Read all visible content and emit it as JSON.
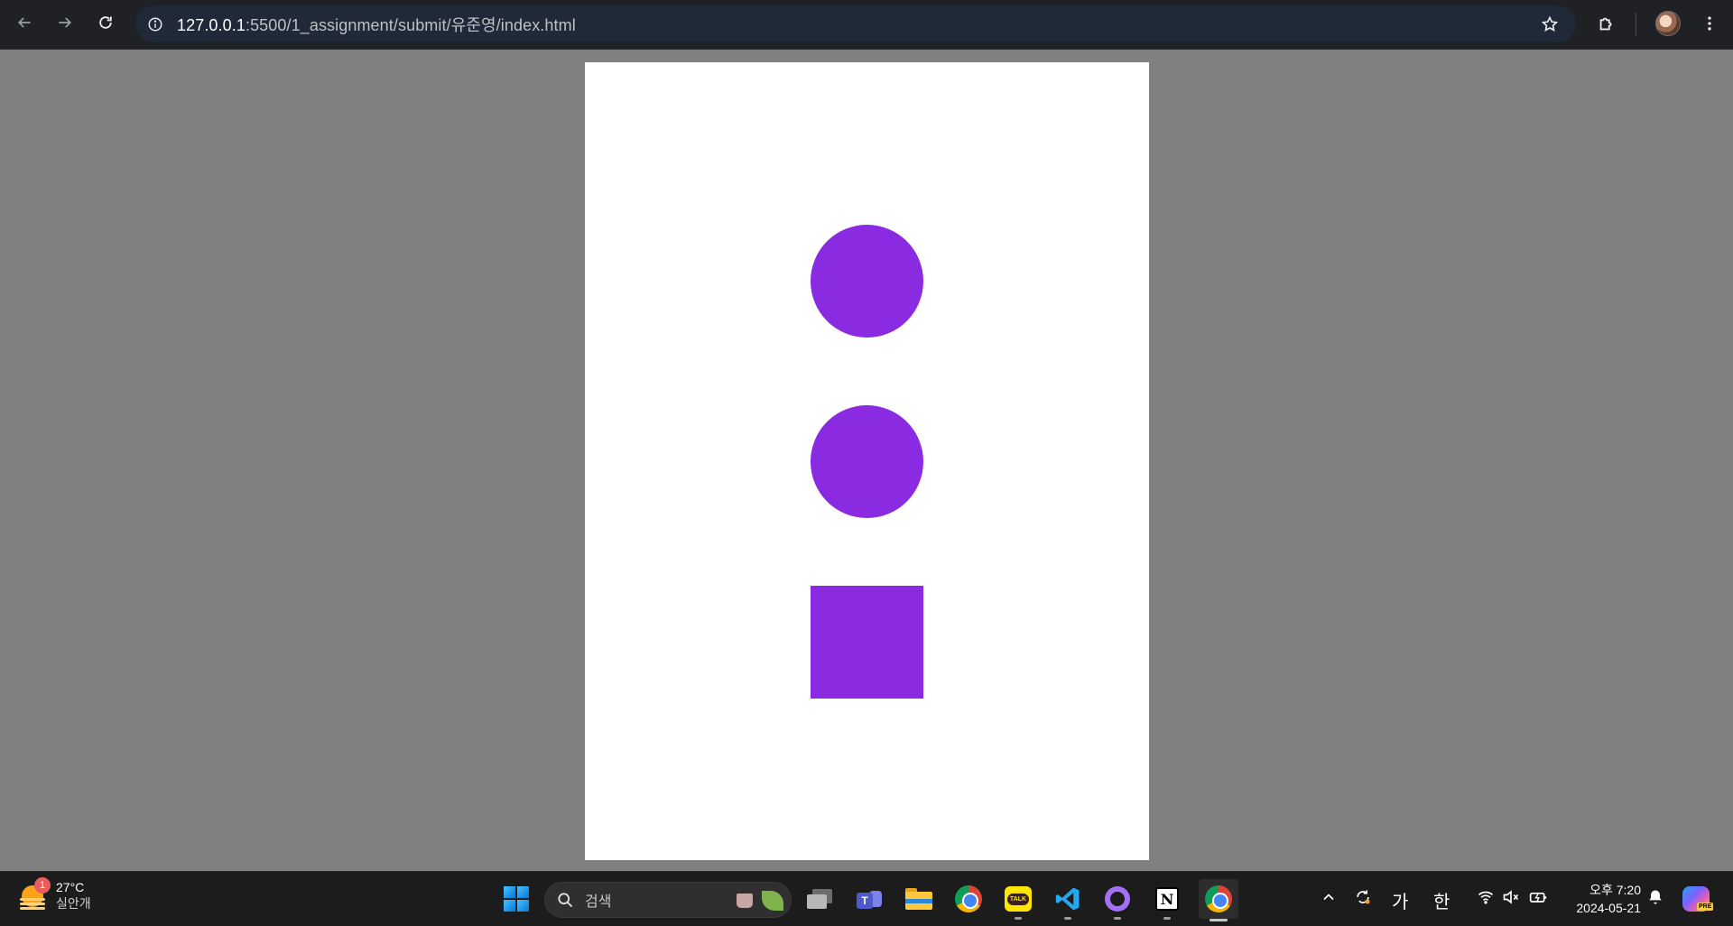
{
  "browser": {
    "url_host": "127.0.0.1",
    "url_path": ":5500/1_assignment/submit/유준영/index.html"
  },
  "page": {
    "shape_color": "#8a2be2",
    "shapes": [
      "circle",
      "circle",
      "square"
    ]
  },
  "taskbar": {
    "weather_badge": "1",
    "weather_temp": "27°C",
    "weather_desc": "실안개",
    "search_label": "검색",
    "kakao_label": "TALK",
    "notion_letter": "N",
    "ime_ga": "가",
    "ime_han": "한",
    "clock_time": "오후 7:20",
    "clock_date": "2024-05-21",
    "copilot_badge": "PRE"
  },
  "icons": {
    "back": "arrow-left-icon",
    "forward": "arrow-right-icon",
    "reload": "reload-icon",
    "info": "info-icon",
    "star": "star-icon",
    "extensions": "puzzle-icon",
    "menu": "kebab-menu-icon"
  }
}
